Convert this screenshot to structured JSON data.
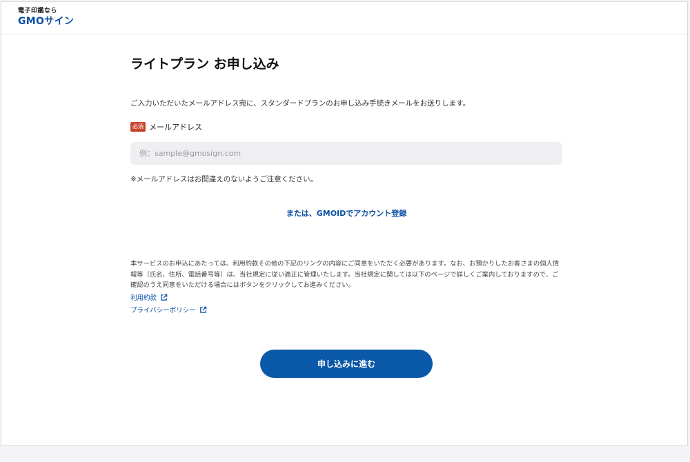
{
  "header": {
    "logo_tagline": "電子印鑑なら",
    "logo_brand": "GMOサイン"
  },
  "main": {
    "title": "ライトプラン お申し込み",
    "intro": "ご入力いただいたメールアドレス宛に、スタンダードプランのお申し込み手続きメールをお送りします。",
    "email_field": {
      "required_label": "必須",
      "label": "メールアドレス",
      "placeholder": "例：sample@gmosign.com",
      "value": ""
    },
    "notice": "※メールアドレスはお間違えのないようご注意ください。",
    "gmoid_link": "または、GMOIDでアカウント登録",
    "terms_text": "本サービスのお申込にあたっては、利用約款その他の下記のリンクの内容にご同意をいただく必要があります。なお、お預かりしたお客さまの個人情報等（氏名、住所、電話番号等）は、当社規定に従い適正に管理いたします。当社規定に関しては以下のページで詳しくご案内しておりますので、ご確認のうえ同意をいただける場合にはボタンをクリックしてお進みください。",
    "links": [
      {
        "label": "利用約款",
        "icon": "external-link-icon"
      },
      {
        "label": "プライバシーポリシー",
        "icon": "external-link-icon"
      }
    ],
    "submit_label": "申し込みに進む"
  },
  "colors": {
    "brand_blue": "#0a4fa3",
    "button_blue": "#0a59a8",
    "required_red": "#c8452d",
    "input_bg": "#efeff1"
  }
}
